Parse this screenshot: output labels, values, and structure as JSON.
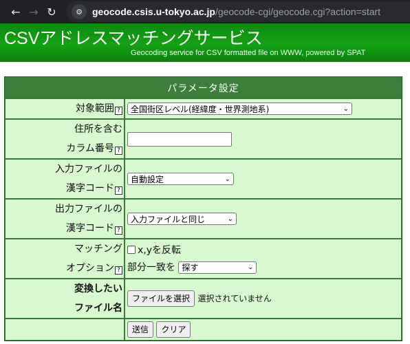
{
  "browser": {
    "url_host": "geocode.csis.u-tokyo.ac.jp",
    "url_path": "/geocode-cgi/geocode.cgi?action=start",
    "site_icon": "tune-icon"
  },
  "header": {
    "title": "CSVアドレスマッチングサービス",
    "subtitle": "Geocoding service for CSV formatted file on WWW, powered by SPAT"
  },
  "form": {
    "heading": "パラメータ設定",
    "help_mark": "?",
    "rows": {
      "target": {
        "label": "対象範囲",
        "value": "全国街区レベル(経緯度・世界測地系)"
      },
      "address_column": {
        "label_line1": "住所を含む",
        "label_line2": "カラム番号",
        "value": ""
      },
      "input_encoding": {
        "label_line1": "入力ファイルの",
        "label_line2": "漢字コード",
        "value": "自動設定"
      },
      "output_encoding": {
        "label_line1": "出力ファイルの",
        "label_line2": "漢字コード",
        "value": "入力ファイルと同じ"
      },
      "matching": {
        "label_line1": "マッチング",
        "label_line2": "オプション",
        "swap_xy_label": "x,yを反転",
        "partial_label": "部分一致を",
        "partial_value": "探す"
      },
      "file": {
        "label_line1": "変換したい",
        "label_line2": "ファイル名",
        "choose_button": "ファイルを選択",
        "no_file_text": "選択されていません"
      }
    },
    "submit_button": "送信",
    "clear_button": "クリア"
  }
}
